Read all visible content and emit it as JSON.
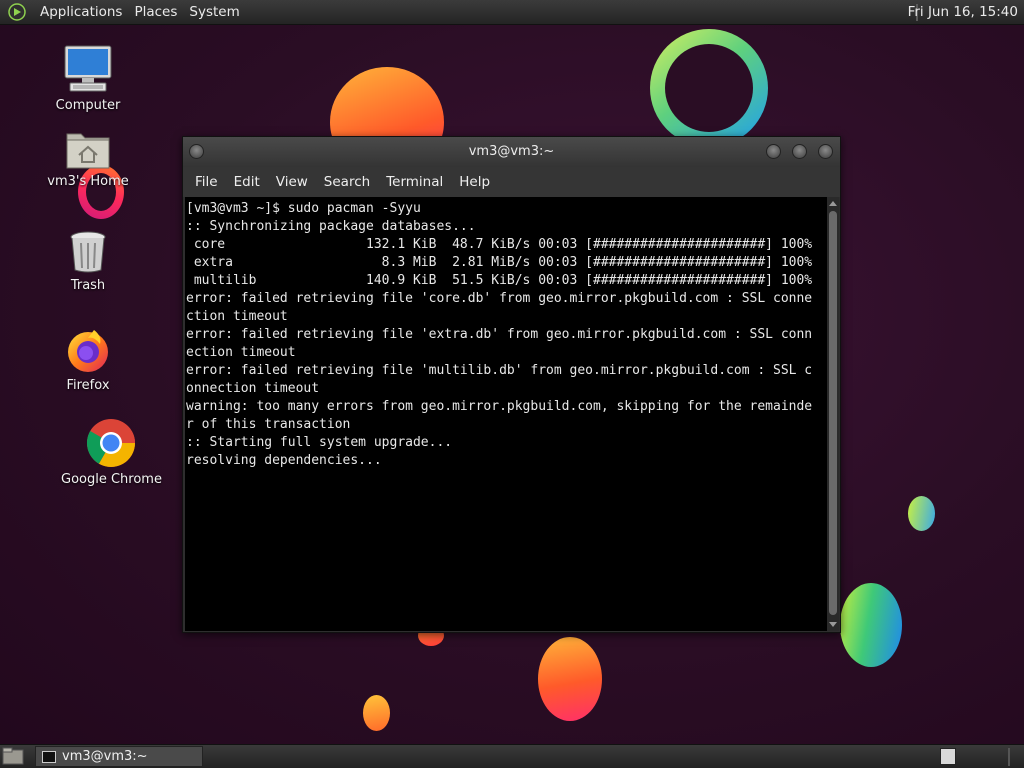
{
  "top_panel": {
    "menus": [
      "Applications",
      "Places",
      "System"
    ],
    "clock": "Fri Jun 16, 15:40"
  },
  "desktop": {
    "icons": [
      {
        "label": "Computer",
        "icon": "computer-icon"
      },
      {
        "label": "vm3's Home",
        "icon": "home-folder-icon"
      },
      {
        "label": "Trash",
        "icon": "trash-icon"
      },
      {
        "label": "Firefox",
        "icon": "firefox-icon"
      },
      {
        "label": "Google Chrome",
        "icon": "chrome-icon"
      }
    ]
  },
  "terminal": {
    "title": "vm3@vm3:~",
    "menu": [
      "File",
      "Edit",
      "View",
      "Search",
      "Terminal",
      "Help"
    ],
    "lines": [
      "[vm3@vm3 ~]$ sudo pacman -Syyu",
      ":: Synchronizing package databases...",
      " core                  132.1 KiB  48.7 KiB/s 00:03 [######################] 100%",
      " extra                   8.3 MiB  2.81 MiB/s 00:03 [######################] 100%",
      " multilib              140.9 KiB  51.5 KiB/s 00:03 [######################] 100%",
      "error: failed retrieving file 'core.db' from geo.mirror.pkgbuild.com : SSL conne",
      "ction timeout",
      "error: failed retrieving file 'extra.db' from geo.mirror.pkgbuild.com : SSL conn",
      "ection timeout",
      "error: failed retrieving file 'multilib.db' from geo.mirror.pkgbuild.com : SSL c",
      "onnection timeout",
      "warning: too many errors from geo.mirror.pkgbuild.com, skipping for the remainde",
      "r of this transaction",
      ":: Starting full system upgrade...",
      "resolving dependencies..."
    ]
  },
  "taskbar": {
    "tasks": [
      {
        "label": "vm3@vm3:~",
        "icon": "terminal-icon"
      }
    ]
  }
}
